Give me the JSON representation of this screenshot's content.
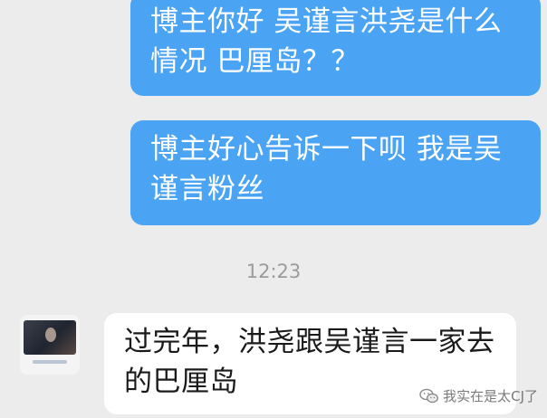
{
  "messages": [
    {
      "direction": "outgoing",
      "lines": [
        "博主你好  吴谨言洪尧是什么",
        "情况  巴厘岛？？"
      ]
    },
    {
      "direction": "outgoing",
      "lines": [
        "博主好心告诉一下呗 我是吴",
        "谨言粉丝"
      ]
    }
  ],
  "timestamp": "12:23",
  "reply": {
    "direction": "incoming",
    "lines": [
      "过完年，洪尧跟吴谨言一家去",
      "的巴厘岛"
    ]
  },
  "watermark": {
    "icon": "wechat-icon",
    "text": "我实在是太CJ了"
  },
  "colors": {
    "background": "#ececec",
    "outgoing_bubble": "#4aa3f3",
    "incoming_bubble": "#ffffff",
    "timestamp": "#9b9b9b"
  }
}
